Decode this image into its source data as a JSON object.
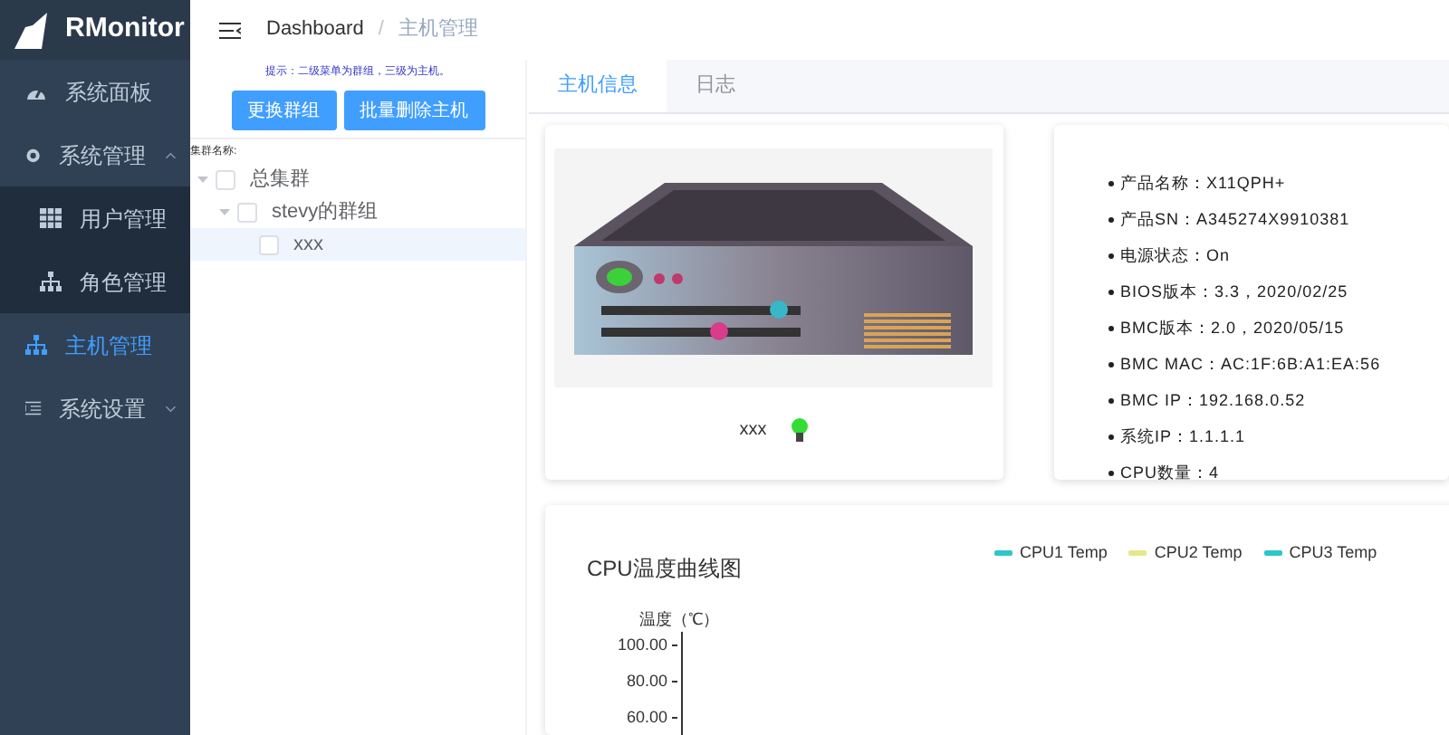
{
  "app": {
    "title": "RMonitor"
  },
  "sidebar": {
    "items": [
      {
        "kind": "dashboard",
        "label": "系统面板",
        "selected": false
      },
      {
        "kind": "settings",
        "label": "系统管理",
        "selected": false,
        "expanded": true,
        "children": [
          {
            "kind": "table",
            "label": "用户管理",
            "selected": false
          },
          {
            "kind": "tree",
            "label": "角色管理",
            "selected": false
          }
        ]
      },
      {
        "kind": "tree",
        "label": "主机管理",
        "selected": true
      },
      {
        "kind": "list",
        "label": "系统设置",
        "selected": false,
        "expanded": false
      }
    ]
  },
  "breadcrumb": {
    "separator": "/",
    "items": [
      "Dashboard",
      "主机管理"
    ]
  },
  "left_panel": {
    "hint": "提示：二级菜单为群组，三级为主机。",
    "buttons": [
      "更换群组",
      "批量删除主机"
    ],
    "tree_label": "集群名称:",
    "tree": [
      {
        "label": "总集群",
        "checked": false,
        "expanded": true,
        "selected": false,
        "children": [
          {
            "label": "stevy的群组",
            "checked": false,
            "expanded": true,
            "selected": false,
            "children": [
              {
                "label": "xxx",
                "checked": false,
                "selected": true
              }
            ]
          }
        ]
      }
    ]
  },
  "tabs": [
    {
      "label": "主机信息",
      "selected": true
    },
    {
      "label": "日志",
      "selected": false
    }
  ],
  "host": {
    "name": "xxx",
    "online": true
  },
  "info": [
    "产品名称：X11QPH+",
    "产品SN：A345274X9910381",
    "电源状态：On",
    "BIOS版本：3.3，2020/02/25",
    "BMC版本：2.0，2020/05/15",
    "BMC MAC：AC:1F:6B:A1:EA:56",
    "BMC IP：192.168.0.52",
    "系统IP：1.1.1.1",
    "CPU数量：4"
  ],
  "chart": {
    "title": "CPU温度曲线图",
    "axis_title": "温度（℃）",
    "legend": [
      {
        "label": "CPU1 Temp",
        "color": "#2ec7c9"
      },
      {
        "label": "CPU2 Temp",
        "color": "#e5e88a"
      },
      {
        "label": "CPU3 Temp",
        "color": "#2ec7c9"
      }
    ],
    "y_tick_labels": [
      "100.00",
      "80.00",
      "60.00"
    ]
  }
}
